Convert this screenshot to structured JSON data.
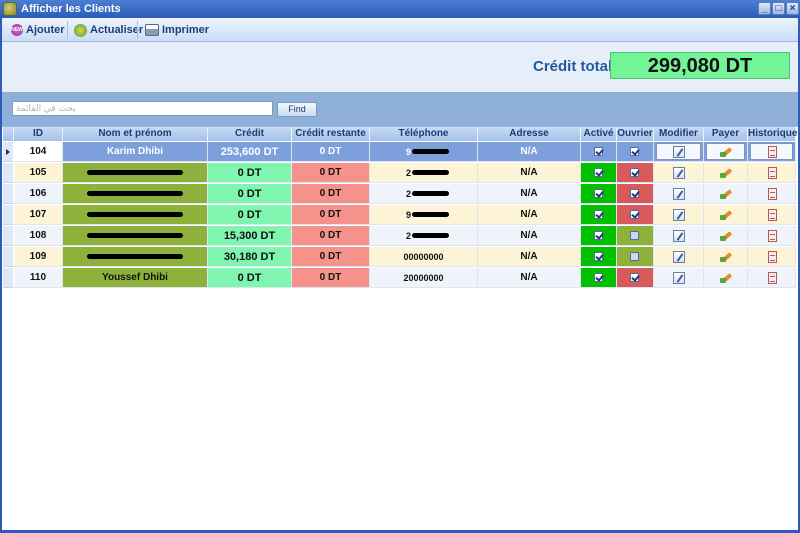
{
  "window": {
    "title": "Afficher les Clients"
  },
  "toolbar": {
    "buttons": [
      {
        "label": "Ajouter",
        "icon": "new-badge-icon"
      },
      {
        "label": "Actualiser",
        "icon": "refresh-icon"
      },
      {
        "label": "Imprimer",
        "icon": "printer-icon"
      }
    ]
  },
  "summary": {
    "label": "Crédit total",
    "value": "299,080 DT"
  },
  "search": {
    "placeholder": "بحث في القائمة",
    "button_label": "Find"
  },
  "grid": {
    "columns": [
      "ID",
      "Nom et prénom",
      "Crédit",
      "Crédit restante",
      "Téléphone",
      "Adresse",
      "Activé",
      "Ouvrier",
      "Modifier",
      "Payer",
      "Historique"
    ],
    "rows": [
      {
        "id": "104",
        "name": "Karim Dhibi",
        "name_redacted": false,
        "credit": "253,600 DT",
        "remaining": "0 DT",
        "phone": "9",
        "phone_redacted": true,
        "address": "N/A",
        "active": true,
        "ouvrier": true,
        "selected": true
      },
      {
        "id": "105",
        "name": "",
        "name_redacted": true,
        "credit": "0 DT",
        "remaining": "0 DT",
        "phone": "2",
        "phone_redacted": true,
        "address": "N/A",
        "active": true,
        "ouvrier": true,
        "selected": false
      },
      {
        "id": "106",
        "name": "",
        "name_redacted": true,
        "credit": "0 DT",
        "remaining": "0 DT",
        "phone": "2",
        "phone_redacted": true,
        "address": "N/A",
        "active": true,
        "ouvrier": true,
        "selected": false
      },
      {
        "id": "107",
        "name": "",
        "name_redacted": true,
        "credit": "0 DT",
        "remaining": "0 DT",
        "phone": "9",
        "phone_redacted": true,
        "address": "N/A",
        "active": true,
        "ouvrier": true,
        "selected": false
      },
      {
        "id": "108",
        "name": "",
        "name_redacted": true,
        "credit": "15,300 DT",
        "remaining": "0 DT",
        "phone": "2",
        "phone_redacted": true,
        "address": "N/A",
        "active": true,
        "ouvrier": false,
        "selected": false
      },
      {
        "id": "109",
        "name": "",
        "name_redacted": true,
        "credit": "30,180 DT",
        "remaining": "0 DT",
        "phone": "00000000",
        "phone_redacted": false,
        "address": "N/A",
        "active": true,
        "ouvrier": false,
        "selected": false
      },
      {
        "id": "110",
        "name": "Youssef Dhibi",
        "name_redacted": false,
        "credit": "0 DT",
        "remaining": "0 DT",
        "phone": "20000000",
        "phone_redacted": false,
        "address": "N/A",
        "active": true,
        "ouvrier": true,
        "selected": false
      }
    ]
  },
  "colors": {
    "name_cell": "#8db13a",
    "credit_cell": "#7ff5b0",
    "remaining_cell": "#f5928c",
    "active_cell": "#00c000",
    "ouvrier_checked": "#d95a5a",
    "ouvrier_unchecked": "#8db13a",
    "row_alt_a": "#eef4f9",
    "row_alt_b": "#fdf3d6",
    "selected_row": "#7da0dc"
  }
}
